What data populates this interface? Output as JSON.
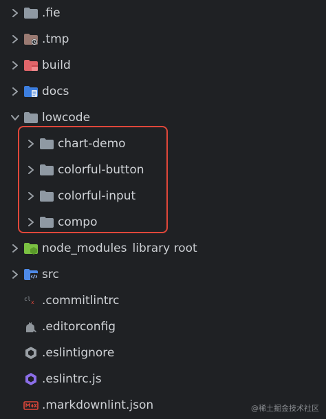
{
  "tree": {
    "items": [
      {
        "label": "​.fie",
        "icon": "folder-icon"
      },
      {
        "label": ".tmp",
        "icon": "folder-clock-icon"
      },
      {
        "label": "build",
        "icon": "folder-build-icon"
      },
      {
        "label": "docs",
        "icon": "folder-docs-icon"
      },
      {
        "label": "lowcode",
        "icon": "folder-icon"
      },
      {
        "label": "chart-demo",
        "icon": "folder-icon"
      },
      {
        "label": "colorful-button",
        "icon": "folder-icon"
      },
      {
        "label": "colorful-input",
        "icon": "folder-icon"
      },
      {
        "label": "compo",
        "icon": "folder-icon"
      },
      {
        "label": "node_modules",
        "suffix": "library root",
        "icon": "folder-node-icon"
      },
      {
        "label": "src",
        "icon": "folder-src-icon"
      },
      {
        "label": ".commitlintrc",
        "icon": "commitlint-icon"
      },
      {
        "label": ".editorconfig",
        "icon": "editorconfig-icon"
      },
      {
        "label": ".eslintignore",
        "icon": "eslintignore-icon"
      },
      {
        "label": ".eslintrc.js",
        "icon": "eslint-icon"
      },
      {
        "label": ".markdownlint.json",
        "icon": "markdownlint-icon"
      }
    ]
  },
  "watermark": "@稀土掘金技术社区",
  "colors": {
    "background": "#1f2124",
    "folder": "#8f99a3",
    "highlight": "#e0473a",
    "node_green": "#7bc142",
    "src_blue": "#4e8ae8",
    "docs_blue": "#3d7fe0",
    "build_red": "#e0656a",
    "tmp_brown": "#9a7a72"
  }
}
